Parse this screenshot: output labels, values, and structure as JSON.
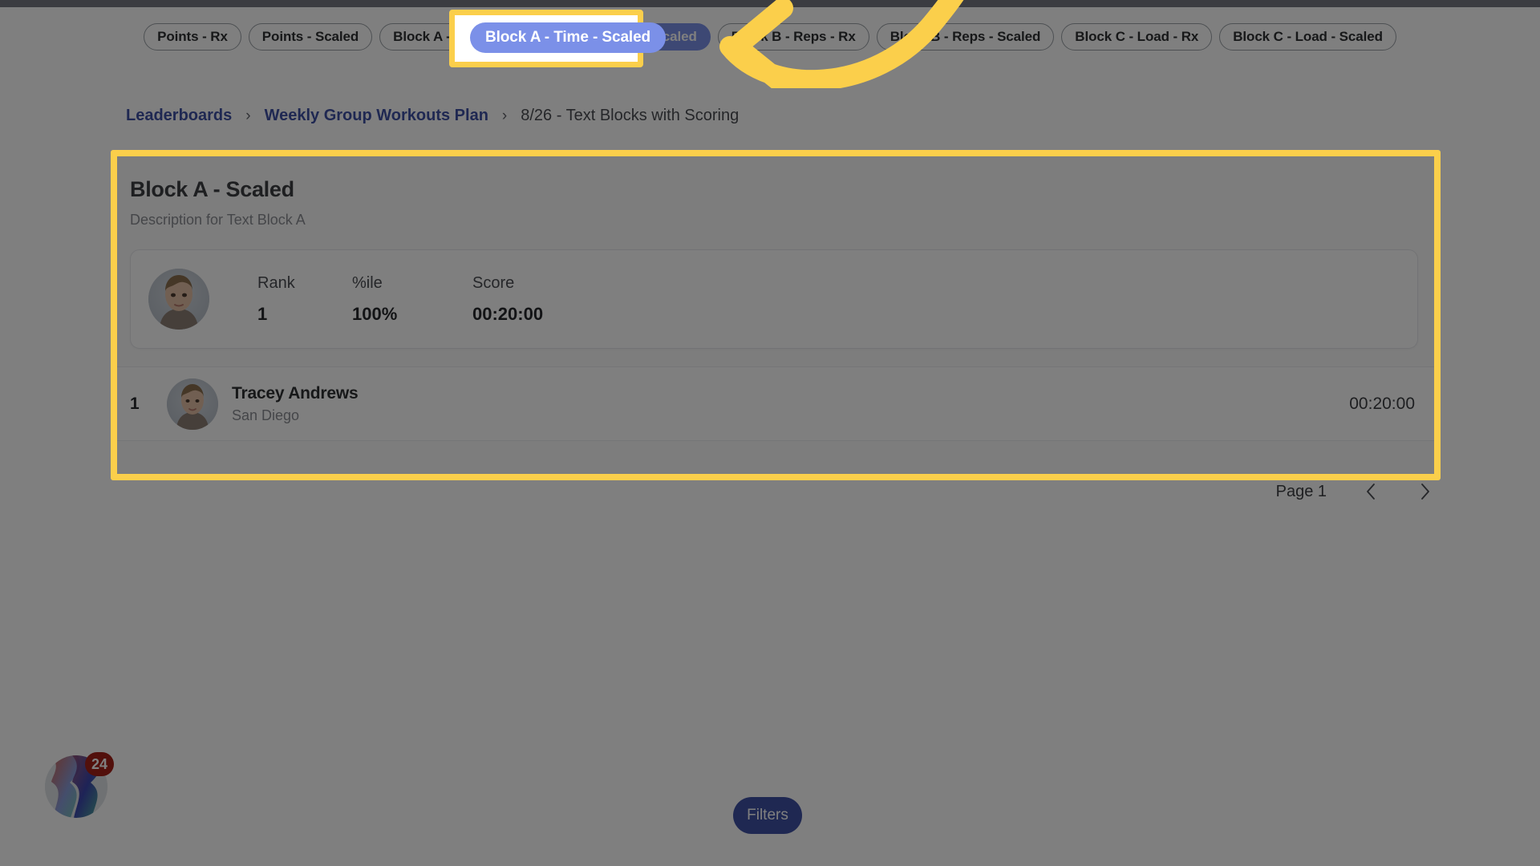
{
  "tabs": [
    {
      "label": "Points - Rx",
      "active": false
    },
    {
      "label": "Points - Scaled",
      "active": false
    },
    {
      "label": "Block A - Time - Rx",
      "active": false
    },
    {
      "label": "Block A - Time - Scaled",
      "active": true
    },
    {
      "label": "Block B - Reps - Rx",
      "active": false
    },
    {
      "label": "Block B - Reps - Scaled",
      "active": false
    },
    {
      "label": "Block C - Load - Rx",
      "active": false
    },
    {
      "label": "Block C - Load - Scaled",
      "active": false
    }
  ],
  "breadcrumb": {
    "root": "Leaderboards",
    "parent": "Weekly Group Workouts Plan",
    "current": "8/26 - Text Blocks with Scoring",
    "separator": "›"
  },
  "board": {
    "title": "Block A - Scaled",
    "description": "Description for Text Block A",
    "my_result": {
      "rank_label": "Rank",
      "rank_value": "1",
      "pct_label": "%ile",
      "pct_value": "100%",
      "score_label": "Score",
      "score_value": "00:20:00"
    },
    "rows": [
      {
        "rank": "1",
        "name": "Tracey Andrews",
        "location": "San Diego",
        "score": "00:20:00"
      }
    ]
  },
  "pagination": {
    "label": "Page 1",
    "prev_icon": "chevron-left-icon",
    "next_icon": "chevron-right-icon"
  },
  "filters": {
    "label": "Filters"
  },
  "help_widget": {
    "badge_count": "24"
  },
  "annotation": {
    "highlighted_tab": "Block A - Time - Scaled",
    "arrow_icon": "curved-arrow-left-icon",
    "highlight_color": "#FBCF4B"
  },
  "colors": {
    "accent_blue": "#7B90E8",
    "link_blue": "#3F51A5",
    "highlight_yellow": "#FBCF4B",
    "badge_red": "#A52019",
    "page_dim": "rgba(0,0,0,0.50)"
  }
}
